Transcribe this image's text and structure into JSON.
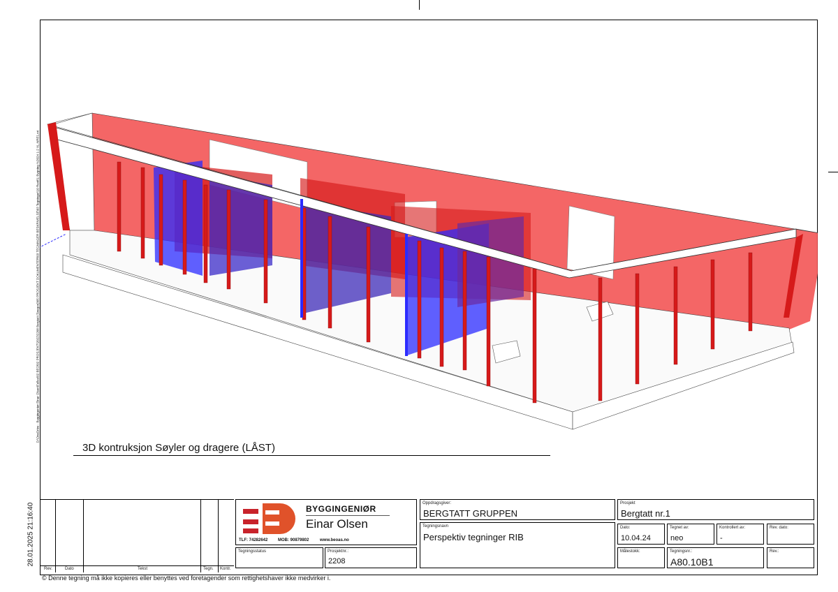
{
  "sheet": {
    "file_path": "D:\\OneDrive - Byggingeniør Einar Olsen\\Felles\\02 BEO\\02 PROSJEKT\\2022\\2208 Bergtatt (Snegon)\\05 PROSJEKT DOKUMENTER\\03 TEGNINGER BESKRIVELSE\\03 Tegninger\\10 Revit\\1 Bygning %2024 1-2 XL-NRE1.rvt",
    "print_datetime": "28.01.2025 21:16:40",
    "view_title": "3D kontruksjon Søyler og dragere (LÅST)",
    "copyright": "© Denne tegning må ikke kopieres eller benyttes ved foretagender som rettighetshaver ikke medvirker i."
  },
  "revision_table": {
    "headers": [
      "Rev.",
      "Dato",
      "Tekst",
      "Tegn.",
      "Kontr."
    ]
  },
  "company": {
    "name_line1": "BYGGINGENIØR",
    "name_line2": "Einar Olsen",
    "phone": "TLF: 74282642",
    "mobile": "MOB: 90879802",
    "website": "www.beoas.no",
    "logo_letters": "BE",
    "brand_red": "#c8232b",
    "brand_orange": "#e0522a"
  },
  "title_block": {
    "tegningsstatus_label": "Tegningsstatus",
    "tegningsstatus_value": "",
    "prosjektnr_label": "Prosjektnr.:",
    "prosjektnr_value": "2208",
    "oppdragsgiver_label": "Oppdragsgiver:",
    "oppdragsgiver_value": "BERGTATT GRUPPEN",
    "tegningsnavn_label": "Tegningsnavn",
    "tegningsnavn_value": "Perspektiv tegninger RIB",
    "prosjekt_label": "Prosjekt",
    "prosjekt_value": "Bergtatt nr.1",
    "dato_label": "Dato:",
    "dato_value": "10.04.24",
    "tegnet_av_label": "Tegnet av:",
    "tegnet_av_value": "neo",
    "kontrollert_av_label": "Kontrollert av:",
    "kontrollert_av_value": "-",
    "rev_dato_label": "Rev. dato:",
    "rev_dato_value": "",
    "malestokk_label": "Målestokk:",
    "malestokk_value": "",
    "tegningsnr_label": "Tegningsnr.:",
    "tegningsnr_value": "A80.10B1",
    "rev_label": "Rev.:",
    "rev_value": ""
  },
  "model_colors": {
    "wall_red": "#f24b4b",
    "column_red": "#d61a1a",
    "wall_blue": "#2b2bff",
    "wall_purple": "#6b2aa0"
  }
}
